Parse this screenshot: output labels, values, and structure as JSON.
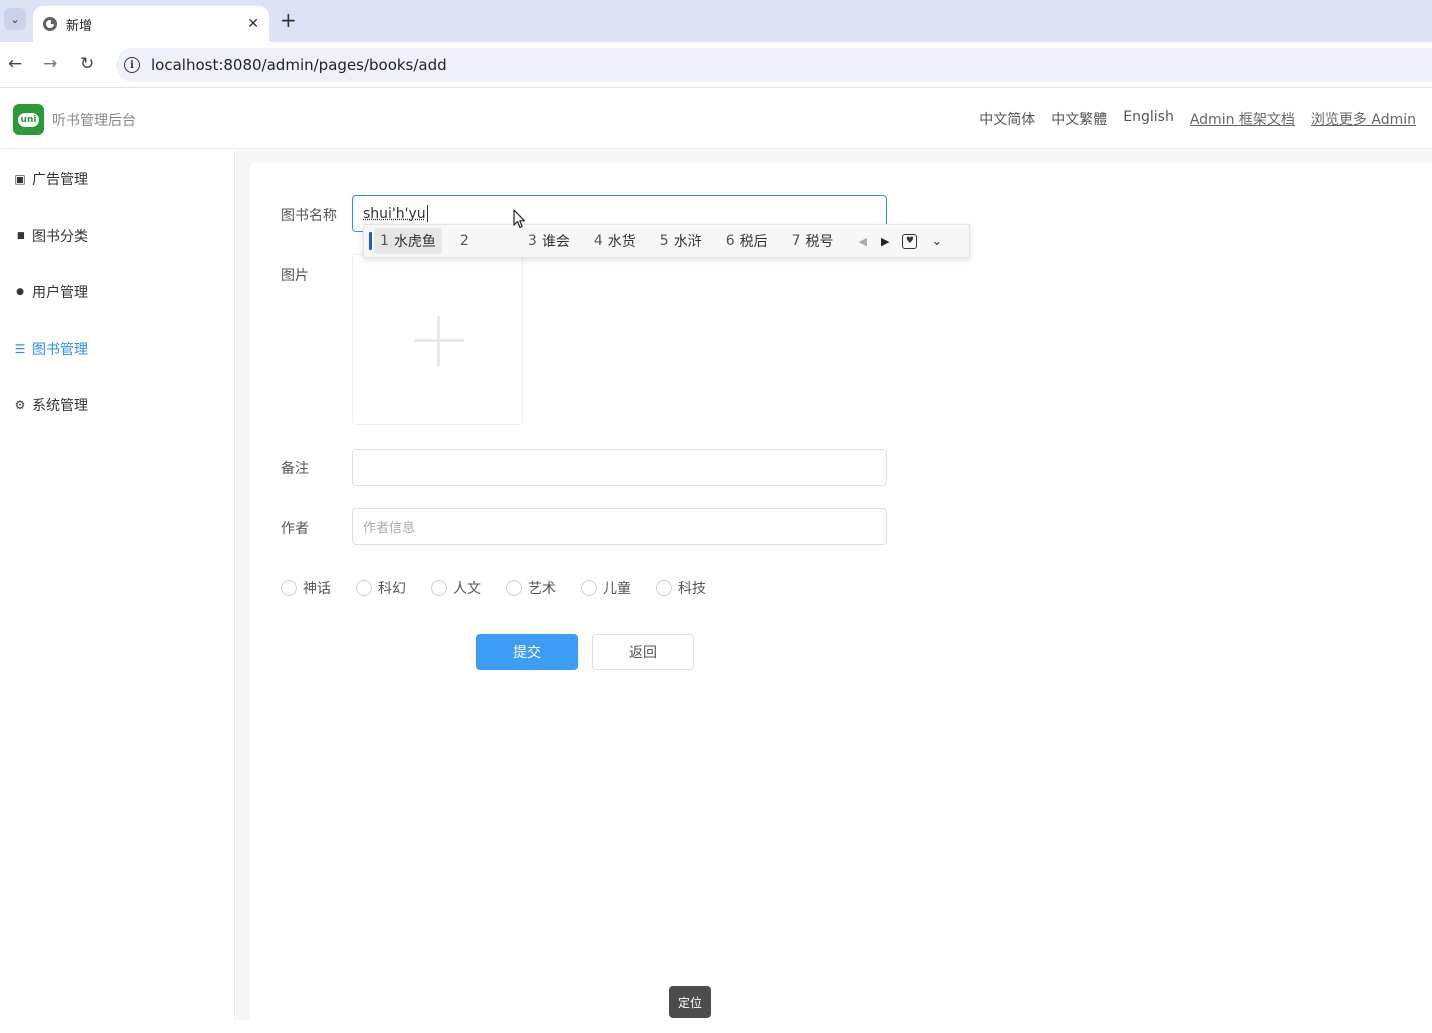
{
  "browser": {
    "tab_title": "新增",
    "tab_close": "✕",
    "new_tab": "+",
    "menu_chevron": "⌄",
    "back": "←",
    "forward": "→",
    "reload": "↻",
    "info": "i",
    "url": "localhost:8080/admin/pages/books/add"
  },
  "header": {
    "logo_text": "uni",
    "brand": "听书管理后台",
    "nav": [
      "中文简体",
      "中文繁體",
      "English",
      "Admin 框架文档",
      "浏览更多 Admin"
    ]
  },
  "sidebar": {
    "items": [
      {
        "label": "广告管理",
        "icon": "ad-icon",
        "glyph": "▣"
      },
      {
        "label": "图书分类",
        "icon": "book-map-icon",
        "glyph": "▮▮"
      },
      {
        "label": "用户管理",
        "icon": "user-icon",
        "glyph": "●"
      },
      {
        "label": "图书管理",
        "icon": "list-icon",
        "glyph": "☰"
      },
      {
        "label": "系统管理",
        "icon": "gear-icon",
        "glyph": "⚙"
      }
    ],
    "active_index": 3
  },
  "form": {
    "name_label": "图书名称",
    "name_value": "shui'h'yu",
    "image_label": "图片",
    "remark_label": "备注",
    "remark_value": "",
    "author_label": "作者",
    "author_placeholder": "作者信息",
    "categories": [
      "神话",
      "科幻",
      "人文",
      "艺术",
      "儿童",
      "科技"
    ],
    "submit_label": "提交",
    "back_label": "返回"
  },
  "ime": {
    "candidates": [
      {
        "n": "1",
        "text": "水虎鱼"
      },
      {
        "n": "2",
        "text": ""
      },
      {
        "n": "3",
        "text": "谁会"
      },
      {
        "n": "4",
        "text": "水货"
      },
      {
        "n": "5",
        "text": "水浒"
      },
      {
        "n": "6",
        "text": "税后"
      },
      {
        "n": "7",
        "text": "税号"
      }
    ],
    "prev": "◀",
    "next": "▶",
    "fav": "♥",
    "expand": "⌄"
  },
  "toast": "定位",
  "colors": {
    "accent": "#2b8ff0",
    "primary_button": "#3b9df5",
    "logo": "#2b9939"
  }
}
